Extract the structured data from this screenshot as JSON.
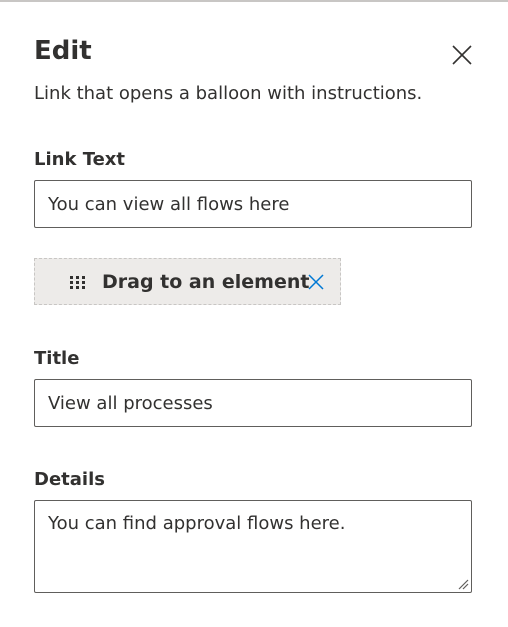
{
  "panel": {
    "title": "Edit",
    "description": "Link that opens a balloon with instructions.",
    "close_icon": "close-icon"
  },
  "link_text": {
    "label": "Link Text",
    "value": "You can view all flows here"
  },
  "target": {
    "label": "Drag to an element",
    "drag_icon": "gripper-icon",
    "remove_icon": "close-icon",
    "accent_color": "#0078d4"
  },
  "title_field": {
    "label": "Title",
    "value": "View all processes"
  },
  "details_field": {
    "label": "Details",
    "value": "You can find approval flows here."
  }
}
